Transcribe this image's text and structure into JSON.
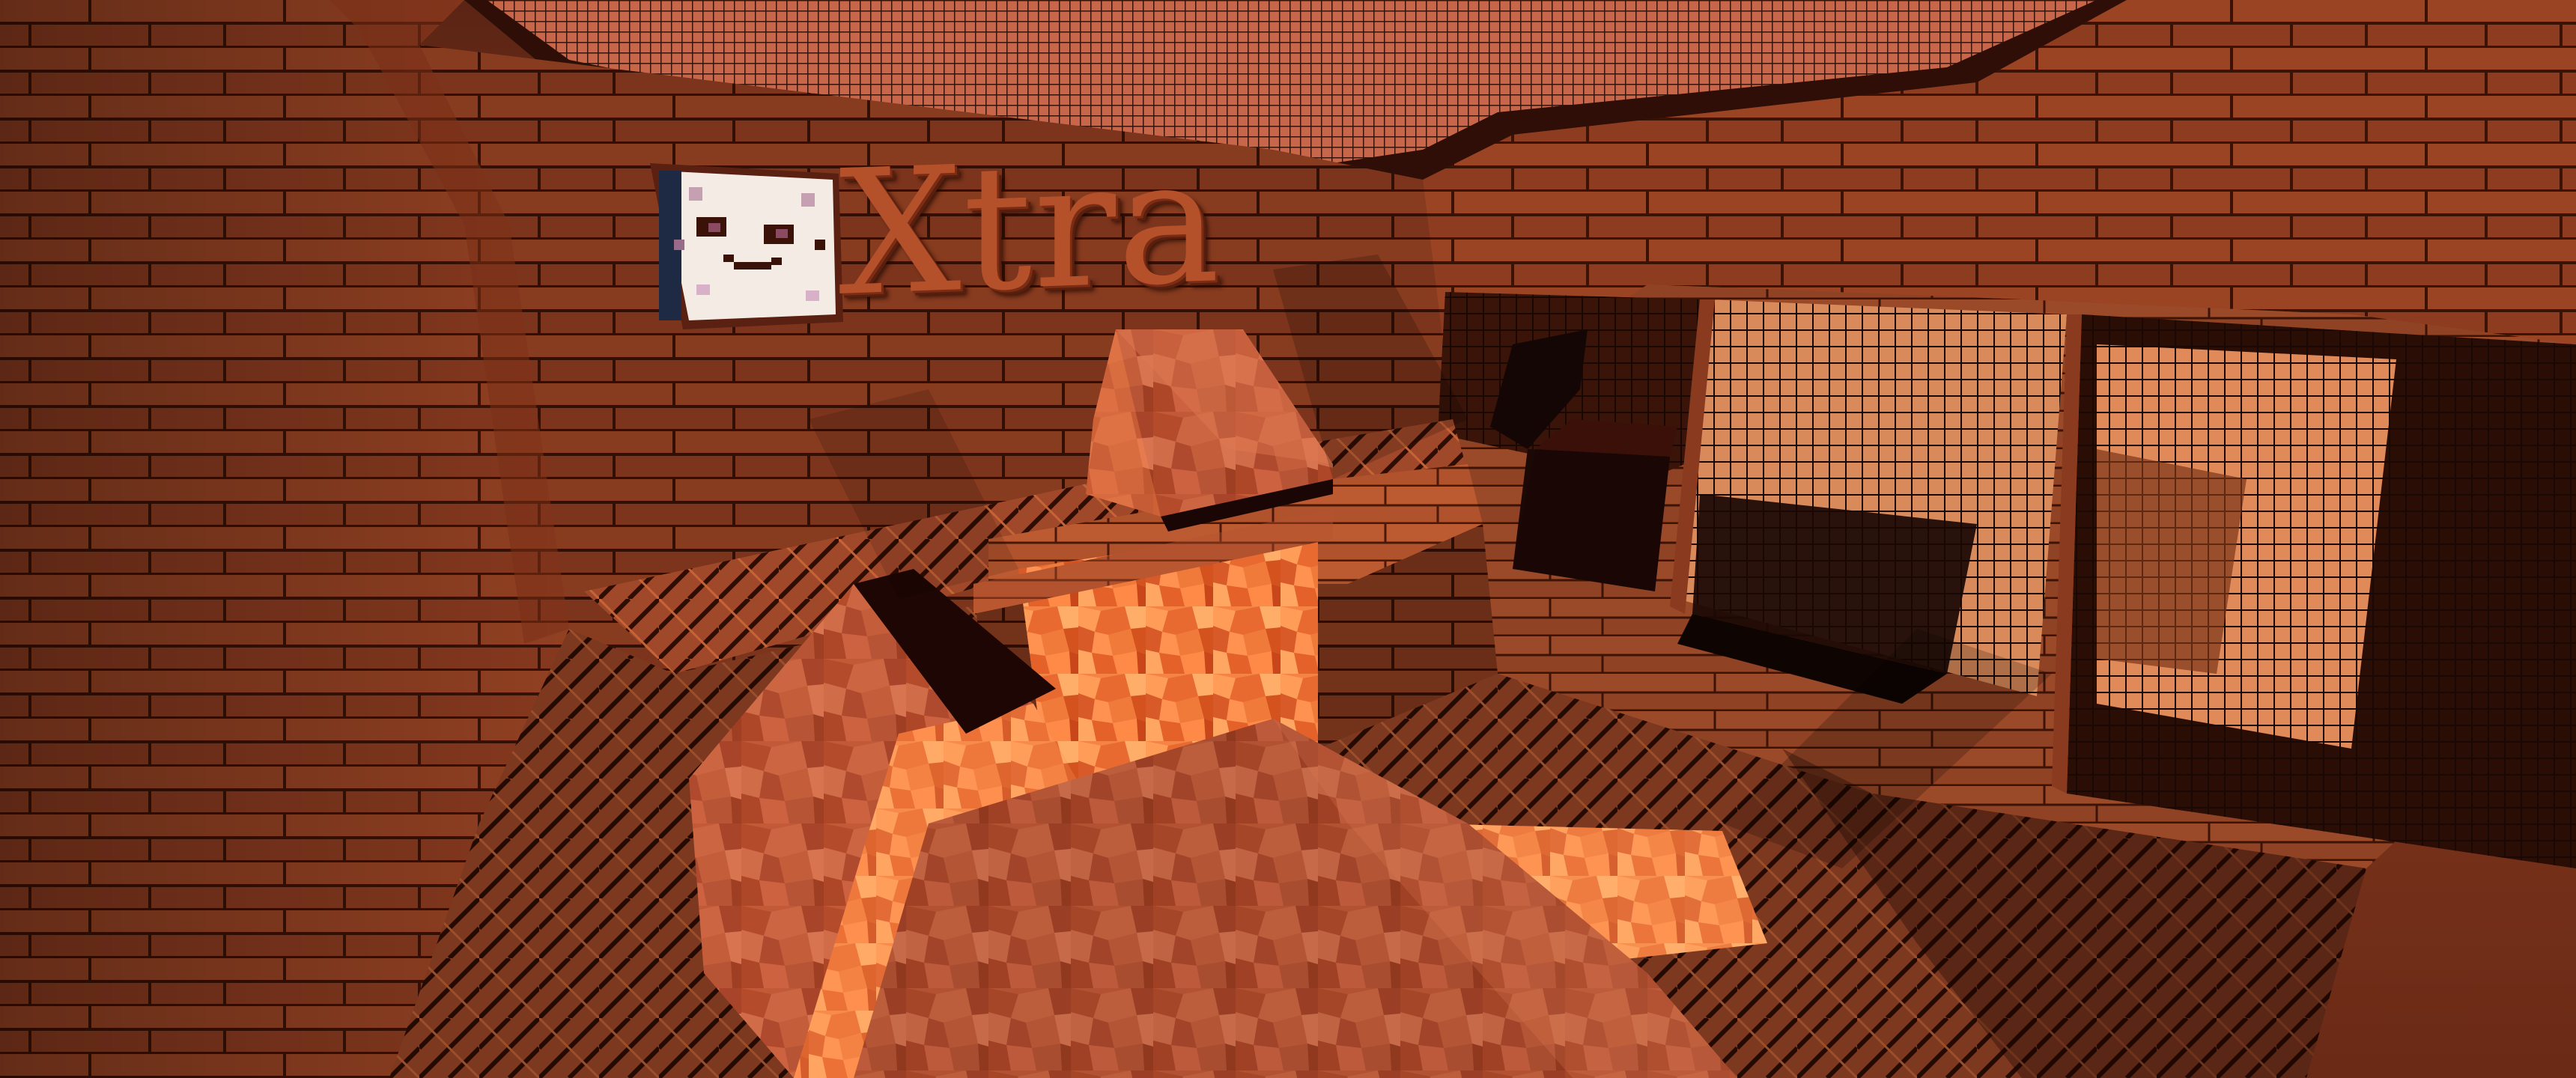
{
  "scene": {
    "sign_text": "Xtra"
  },
  "colors": {
    "wood_dark": "#6a2814",
    "wood_mid": "#9c4424",
    "wood_light": "#c4603a",
    "lava_bright": "#ff9a50",
    "lava_mid": "#f07438",
    "lava_dark": "#c8441c",
    "grate": "#1e0a04",
    "shadow": "#2a0c04"
  },
  "icons": {
    "emblem": "pixel-cat-face-icon"
  }
}
